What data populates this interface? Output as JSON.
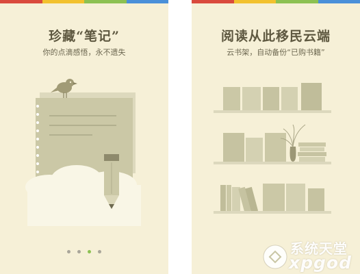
{
  "colors": {
    "background": "#f6f0d7",
    "top_bar": [
      "#d94a3d",
      "#f2c12e",
      "#8cc152",
      "#4a90d9"
    ],
    "accent_dot": "#8cc152",
    "illustration": "#c9c6a5"
  },
  "screen_left": {
    "title": "珍藏“笔记”",
    "subtitle": "你的点滴感悟，永不遗失",
    "illustration": [
      "bird-icon",
      "notepad-icon",
      "pencil-icon",
      "cloud-icon"
    ]
  },
  "screen_right": {
    "title": "阅读从此移民云端",
    "subtitle": "云书架，自动备份“已购书籍”",
    "illustration": [
      "bookshelf-icon",
      "vase-icon",
      "book-stack-icon"
    ]
  },
  "pager": {
    "count": 4,
    "active_index": 2
  },
  "watermark": {
    "cn": "系统天堂",
    "en": "xpgod"
  }
}
